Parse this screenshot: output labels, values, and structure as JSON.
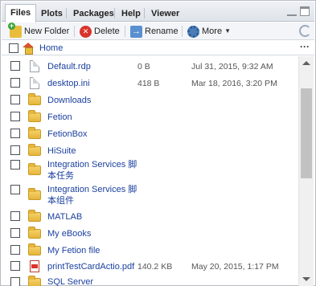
{
  "tabs": [
    {
      "label": "Files",
      "active": true
    },
    {
      "label": "Plots",
      "active": false
    },
    {
      "label": "Packages",
      "active": false
    },
    {
      "label": "Help",
      "active": false
    },
    {
      "label": "Viewer",
      "active": false
    }
  ],
  "toolbar": {
    "new_folder": "New Folder",
    "delete": "Delete",
    "rename": "Rename",
    "more": "More"
  },
  "breadcrumb": {
    "home": "Home",
    "overflow": "···"
  },
  "files": [
    {
      "name": "Default.rdp",
      "size": "0 B",
      "modified": "Jul 31, 2015, 9:32 AM",
      "kind": "file"
    },
    {
      "name": "desktop.ini",
      "size": "418 B",
      "modified": "Mar 18, 2016, 3:20 PM",
      "kind": "file"
    },
    {
      "name": "Downloads",
      "size": "",
      "modified": "",
      "kind": "folder"
    },
    {
      "name": "Fetion",
      "size": "",
      "modified": "",
      "kind": "folder"
    },
    {
      "name": "FetionBox",
      "size": "",
      "modified": "",
      "kind": "folder"
    },
    {
      "name": "HiSuite",
      "size": "",
      "modified": "",
      "kind": "folder"
    },
    {
      "name": "Integration Services 脚",
      "name2": "本任务",
      "size": "",
      "modified": "",
      "kind": "folder"
    },
    {
      "name": "Integration Services 脚",
      "name2": "本组件",
      "size": "",
      "modified": "",
      "kind": "folder"
    },
    {
      "name": "MATLAB",
      "size": "",
      "modified": "",
      "kind": "folder"
    },
    {
      "name": "My eBooks",
      "size": "",
      "modified": "",
      "kind": "folder"
    },
    {
      "name": "My Fetion file",
      "size": "",
      "modified": "",
      "kind": "folder"
    },
    {
      "name": "printTestCardActio.pdf",
      "size": "140.2 KB",
      "modified": "May 20, 2015, 1:17 PM",
      "kind": "pdf"
    },
    {
      "name": "SQL Server",
      "size": "",
      "modified": "",
      "kind": "folder"
    }
  ],
  "icons": {
    "new_folder": "new-folder-icon",
    "delete": "delete-icon",
    "rename": "rename-icon",
    "more": "gear-icon",
    "refresh": "refresh-icon",
    "home": "home-icon"
  }
}
